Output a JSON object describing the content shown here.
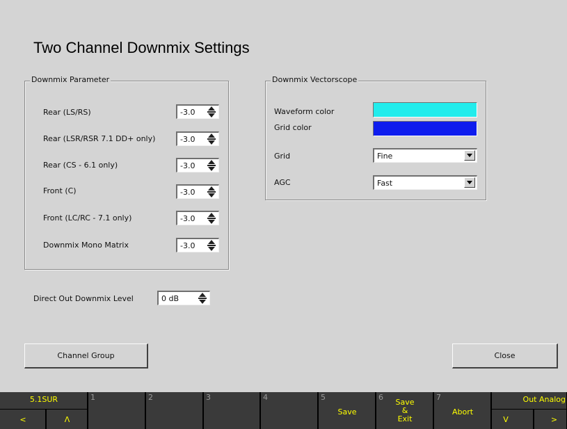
{
  "page_title": "Two Channel Downmix Settings",
  "downmix_parameter": {
    "group_label": "Downmix Parameter",
    "rows": [
      {
        "label": "Rear (LS/RS)",
        "value": "-3.0"
      },
      {
        "label": "Rear (LSR/RSR 7.1 DD+ only)",
        "value": "-3.0"
      },
      {
        "label": "Rear (CS - 6.1 only)",
        "value": "-3.0"
      },
      {
        "label": "Front (C)",
        "value": "-3.0"
      },
      {
        "label": "Front (LC/RC - 7.1 only)",
        "value": "-3.0"
      },
      {
        "label": "Downmix Mono Matrix",
        "value": "-3.0"
      }
    ]
  },
  "vectorscope": {
    "group_label": "Downmix Vectorscope",
    "waveform_color_label": "Waveform color",
    "waveform_color": "#22ecec",
    "grid_color_label": "Grid color",
    "grid_color": "#0e1cee",
    "grid_label": "Grid",
    "grid_value": "Fine",
    "agc_label": "AGC",
    "agc_value": "Fast"
  },
  "direct_out": {
    "label": "Direct Out Downmix Level",
    "value": "0 dB"
  },
  "buttons": {
    "channel_group": "Channel Group",
    "close": "Close"
  },
  "softkeys": {
    "left_top": "5.1SUR",
    "left_bottom_left": "<",
    "left_bottom_right": "Λ",
    "keys": [
      {
        "num": "1",
        "label": ""
      },
      {
        "num": "2",
        "label": ""
      },
      {
        "num": "3",
        "label": ""
      },
      {
        "num": "4",
        "label": ""
      },
      {
        "num": "5",
        "label": "Save"
      },
      {
        "num": "6",
        "label_line1": "Save",
        "label_line2": "&",
        "label_line3": "Exit"
      },
      {
        "num": "7",
        "label": "Abort"
      }
    ],
    "right_top": "Out Analog",
    "right_bottom_left": "V",
    "right_bottom_right": ">"
  },
  "colors": {
    "background": "#d4d4d4",
    "softkey_text": "#ffff00",
    "softkey_bg": "#3a3a3a"
  }
}
